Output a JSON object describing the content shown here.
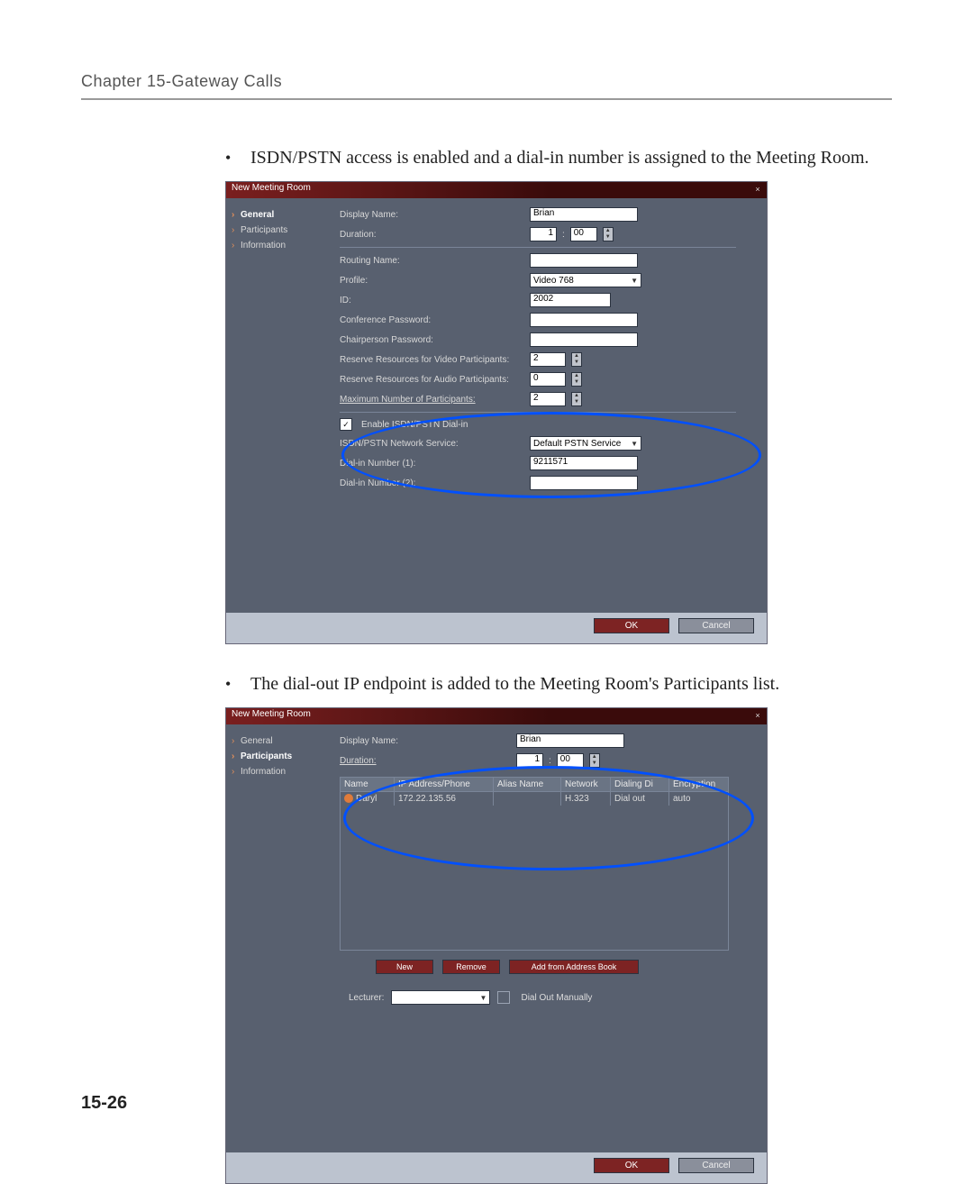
{
  "header": "Chapter 15-Gateway Calls",
  "page_number": "15-26",
  "bullet1": "ISDN/PSTN access is enabled and a dial-in number is assigned to the Meeting Room.",
  "bullet2": "The dial-out IP endpoint is added to the Meeting Room's Participants list.",
  "dialog1": {
    "title": "New Meeting Room",
    "sidebar": {
      "items": [
        "General",
        "Participants",
        "Information"
      ],
      "active": "General"
    },
    "labels": {
      "display_name": "Display Name:",
      "duration": "Duration:",
      "routing_name": "Routing Name:",
      "profile": "Profile:",
      "id": "ID:",
      "conf_pwd": "Conference Password:",
      "chair_pwd": "Chairperson Password:",
      "res_video": "Reserve Resources for Video Participants:",
      "res_audio": "Reserve Resources for Audio Participants:",
      "max_part": "Maximum Number of Participants:",
      "enable_isdn": "Enable ISDN/PSTN Dial-in",
      "isdn_svc": "ISDN/PSTN Network Service:",
      "dialin1": "Dial-in Number (1):",
      "dialin2": "Dial-in Number (2):"
    },
    "values": {
      "display_name": "Brian",
      "duration_h": "1",
      "duration_m": "00",
      "routing_name": "",
      "profile": "Video 768",
      "id": "2002",
      "conf_pwd": "",
      "chair_pwd": "",
      "res_video": "2",
      "res_audio": "0",
      "max_part": "2",
      "enable_isdn_checked": "✓",
      "isdn_svc": "Default PSTN Service",
      "dialin1": "9211571",
      "dialin2": ""
    },
    "buttons": {
      "ok": "OK",
      "cancel": "Cancel"
    }
  },
  "dialog2": {
    "title": "New Meeting Room",
    "sidebar": {
      "items": [
        "General",
        "Participants",
        "Information"
      ],
      "active": "Participants"
    },
    "labels": {
      "display_name": "Display Name:",
      "duration": "Duration:",
      "lecturer": "Lecturer:",
      "dial_out_manually": "Dial Out Manually"
    },
    "values": {
      "display_name": "Brian",
      "duration_h": "1",
      "duration_m": "00",
      "lecturer": ""
    },
    "columns": [
      "Name",
      "IP Address/Phone",
      "Alias Name",
      "Network",
      "Dialing Di",
      "Encryption"
    ],
    "rows": [
      {
        "name": "Daryl",
        "ip": "172.22.135.56",
        "alias": "",
        "network": "H.323",
        "dialing": "Dial out",
        "encryption": "auto"
      }
    ],
    "action_buttons": {
      "new": "New",
      "remove": "Remove",
      "add_book": "Add from Address Book"
    },
    "buttons": {
      "ok": "OK",
      "cancel": "Cancel"
    }
  }
}
